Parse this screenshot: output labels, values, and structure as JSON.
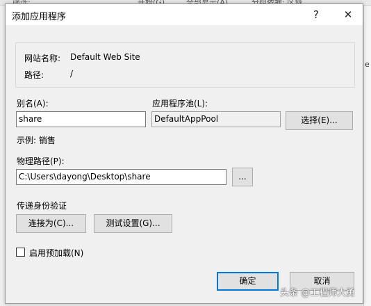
{
  "background": {
    "strip_texts": [
      "筛选:",
      "开始(G)",
      "全部显示(A)",
      "分组依据: 区域"
    ],
    "right_edge_text": "e"
  },
  "dialog": {
    "title": "添加应用程序",
    "help_glyph": "?",
    "close_glyph": "✕"
  },
  "info": {
    "site_name_label": "网站名称:",
    "site_name_value": "Default Web Site",
    "path_label": "路径:",
    "path_value": "/"
  },
  "alias": {
    "label": "别名(A):",
    "value": "share",
    "example": "示例: 销售"
  },
  "app_pool": {
    "label": "应用程序池(L):",
    "value": "DefaultAppPool",
    "select_button": "选择(E)..."
  },
  "physical_path": {
    "label": "物理路径(P):",
    "value": "C:\\Users\\dayong\\Desktop\\share",
    "browse_button": "..."
  },
  "pass_through": {
    "label": "传递身份验证",
    "connect_as_button": "连接为(C)...",
    "test_settings_button": "测试设置(G)..."
  },
  "preload": {
    "label": "启用预加载(N)",
    "checked": false
  },
  "footer": {
    "ok_button": "确定",
    "cancel_button": "取消"
  },
  "watermark": "头条 @工程师大勇",
  "colors": {
    "default_button_border": "#0078d7",
    "dialog_background": "#f0f0f0",
    "titlebar_background": "#ffffff"
  }
}
